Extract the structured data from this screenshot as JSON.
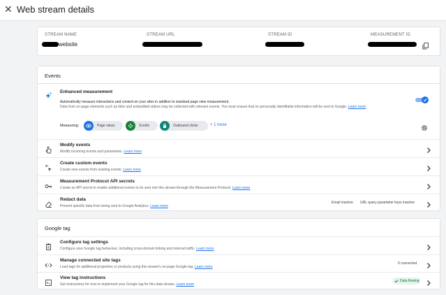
{
  "header": {
    "title": "Web stream details",
    "close_icon": "close-icon"
  },
  "stream": {
    "name_label": "STREAM NAME",
    "name_value": "website",
    "url_label": "STREAM URL",
    "id_label": "STREAM ID",
    "measurement_label": "MEASUREMENT ID",
    "copy_icon": "copy-icon"
  },
  "events": {
    "section_title": "Events",
    "enhanced": {
      "title": "Enhanced measurement",
      "desc1": "Automatically measure interactions and content on your sites in addition to standard page view measurement.",
      "desc2": "Data from on-page elements such as links and embedded videos may be collected with relevant events. You must ensure that no personally identifiable information will be sent to Google.",
      "learn_more": "Learn more",
      "toggle_on": true,
      "measuring_label": "Measuring:",
      "chips": [
        {
          "label": "Page views",
          "icon": "eye-icon",
          "color": "#1a73e8"
        },
        {
          "label": "Scrolls",
          "icon": "scroll-arrows-icon",
          "color": "#188038"
        },
        {
          "label": "Outbound clicks",
          "icon": "lock-icon",
          "color": "#12857a"
        }
      ],
      "more": "+ 1 more"
    },
    "rows": [
      {
        "title": "Modify events",
        "desc": "Modify incoming events and parameters.",
        "link": "Learn more",
        "icon": "touch-hand-icon"
      },
      {
        "title": "Create custom events",
        "desc": "Create new events from existing events.",
        "link": "Learn more",
        "icon": "sparkle-click-icon"
      },
      {
        "title": "Measurement Protocol API secrets",
        "desc": "Create an API secret to enable additional events to be sent into this stream through the Measurement Protocol.",
        "link": "Learn more",
        "icon": "key-icon"
      },
      {
        "title": "Redact data",
        "desc": "Prevent specific data from being sent to Google Analytics.",
        "link": "Learn more",
        "icon": "eraser-icon",
        "status1": "Email inactive",
        "status2": "URL query parameter keys inactive"
      }
    ]
  },
  "gtag": {
    "section_title": "Google tag",
    "rows": [
      {
        "title": "Configure tag settings",
        "desc": "Configure your Google tag behaviour, including cross-domain linking and internal traffic.",
        "link": "Learn more",
        "icon": "tag-icon"
      },
      {
        "title": "Manage connected site tags",
        "desc": "Load tags for additional properties or products using this stream's on-page Google tag.",
        "link": "Learn more",
        "icon": "code-brackets-icon",
        "status": "0 connected"
      },
      {
        "title": "View tag instructions",
        "desc": "Get instructions for how to implement your Google tag for this data stream.",
        "link": "Learn more",
        "icon": "instructions-icon",
        "status": "Data flowing"
      }
    ]
  }
}
